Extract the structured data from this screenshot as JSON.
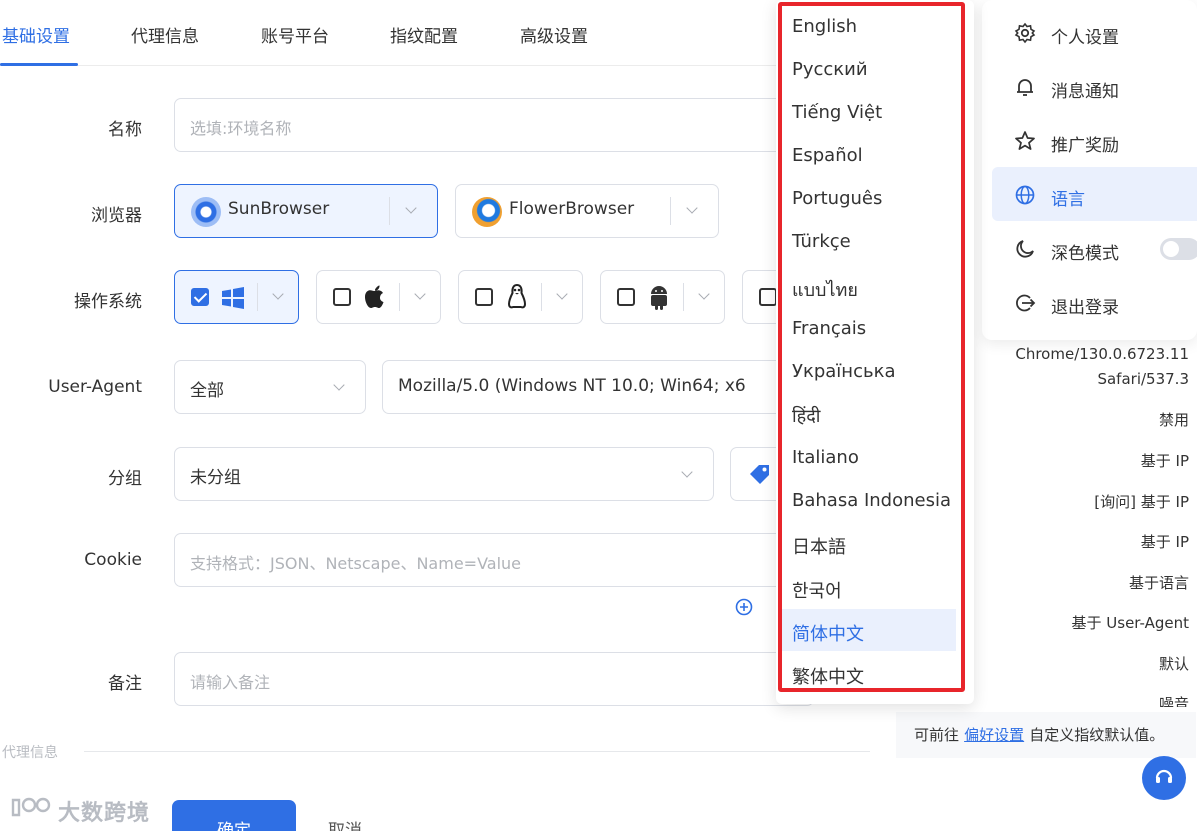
{
  "tabs": [
    "基础设置",
    "代理信息",
    "账号平台",
    "指纹配置",
    "高级设置"
  ],
  "form": {
    "name_label": "名称",
    "name_placeholder": "选填:环境名称",
    "browser_label": "浏览器",
    "browsers": [
      "SunBrowser",
      "FlowerBrowser"
    ],
    "os_label": "操作系统",
    "ua_label": "User-Agent",
    "ua_scope": "全部",
    "ua_value": "Mozilla/5.0 (Windows NT 10.0; Win64; x6",
    "group_label": "分组",
    "group_value": "未分组",
    "cookie_label": "Cookie",
    "cookie_placeholder": "支持格式：JSON、Netscape、Name=Value",
    "note_label": "备注",
    "note_placeholder": "请输入备注"
  },
  "section_proxy": "代理信息",
  "actions": {
    "confirm": "确定",
    "cancel": "取消"
  },
  "brand": {
    "name": "大数跨境"
  },
  "right_panel": {
    "ua_text_1": "Chrome/130.0.6723.11",
    "ua_text_2": "Safari/537.3",
    "values": [
      "禁用",
      "基于 IP",
      "[询问] 基于 IP",
      "基于 IP",
      "基于语言",
      "基于 User-Agent",
      "默认",
      "噪音"
    ],
    "hint_prefix": "可前往",
    "hint_link": "偏好设置",
    "hint_suffix": "自定义指纹默认值。"
  },
  "user_menu": {
    "items": [
      "个人设置",
      "消息通知",
      "推广奖励",
      "语言",
      "深色模式",
      "退出登录"
    ],
    "active": "语言"
  },
  "languages": [
    "English",
    "Русский",
    "Tiếng Việt",
    "Español",
    "Português",
    "Türkçe",
    "แบบไทย",
    "Français",
    "Українська",
    "हिंदी",
    "Italiano",
    "Bahasa Indonesia",
    "日本語",
    "한국어",
    "简体中文",
    "繁体中文"
  ],
  "active_language": "简体中文",
  "colors": {
    "accent": "#2f6fe4",
    "highlight_box": "#e8252b"
  }
}
